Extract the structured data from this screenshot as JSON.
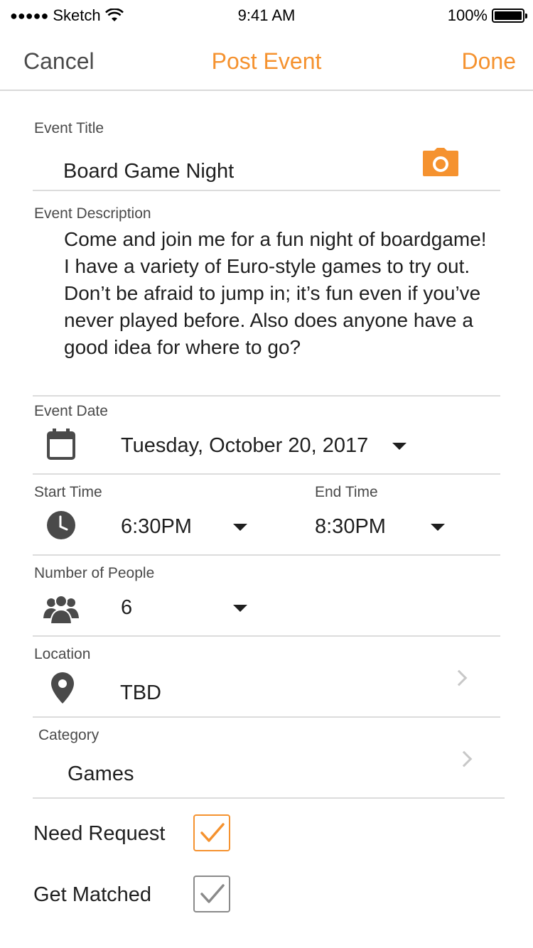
{
  "status_bar": {
    "signal": "●●●●●",
    "carrier": "Sketch",
    "time": "9:41 AM",
    "battery": "100%"
  },
  "nav": {
    "cancel": "Cancel",
    "title": "Post Event",
    "done": "Done"
  },
  "colors": {
    "accent": "#f5922f",
    "icon_gray": "#4a4a4a"
  },
  "form": {
    "title_label": "Event Title",
    "title_value": "Board Game Night",
    "description_label": "Event Description",
    "description_value": "Come and join me for a fun night of boardgame! I have a variety of Euro-style games to try out. Don’t be afraid to jump in; it’s fun even if you’ve never played before. Also does anyone have a good idea for where to go?",
    "date_label": "Event Date",
    "date_value": "Tuesday, October 20, 2017",
    "start_label": "Start Time",
    "start_value": "6:30PM",
    "end_label": "End Time",
    "end_value": "8:30PM",
    "people_label": "Number of People",
    "people_value": "6",
    "location_label": "Location",
    "location_value": "TBD",
    "category_label": "Category",
    "category_value": "Games",
    "need_request_label": "Need Request",
    "need_request_checked": true,
    "get_matched_label": "Get Matched",
    "get_matched_checked": true
  },
  "icons": {
    "camera": "camera-icon",
    "calendar": "calendar-icon",
    "clock": "clock-icon",
    "people": "people-icon",
    "location": "location-pin-icon"
  }
}
